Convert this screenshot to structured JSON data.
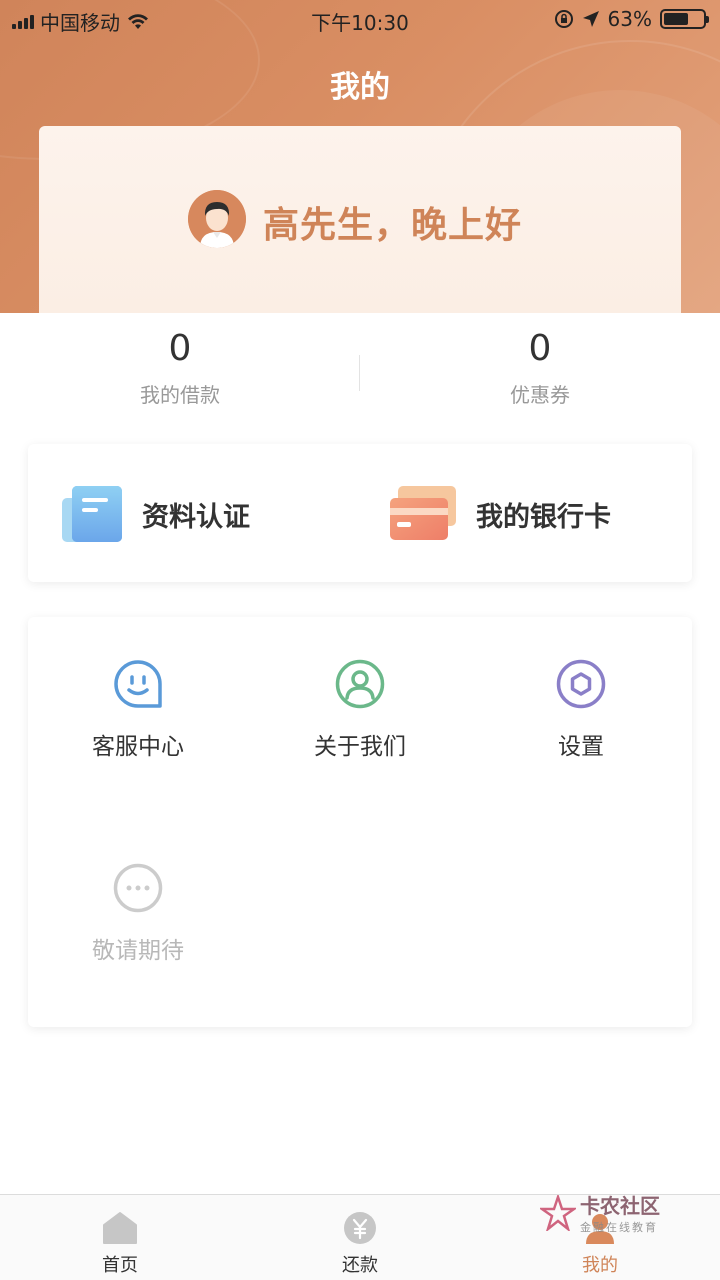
{
  "status_bar": {
    "carrier": "中国移动",
    "time": "下午10:30",
    "battery_percent": "63%",
    "battery_level": 0.63,
    "icons": [
      "signal-icon",
      "wifi-icon",
      "rotation-lock-icon",
      "location-icon",
      "battery-icon"
    ]
  },
  "header": {
    "title": "我的",
    "background_color": "#d98e63"
  },
  "profile": {
    "greeting": "高先生，晚上好",
    "avatar_icon": "user-avatar-icon",
    "accent_color": "#cf8458"
  },
  "stats": [
    {
      "value": "0",
      "label": "我的借款"
    },
    {
      "value": "0",
      "label": "优惠券"
    }
  ],
  "quick_actions": [
    {
      "label": "资料认证",
      "icon": "document-icon"
    },
    {
      "label": "我的银行卡",
      "icon": "bank-card-icon"
    }
  ],
  "services": [
    {
      "label": "客服中心",
      "icon": "smiley-chat-icon",
      "color": "#5a9ad8"
    },
    {
      "label": "关于我们",
      "icon": "user-circle-icon",
      "color": "#6bb88a"
    },
    {
      "label": "设置",
      "icon": "hexagon-settings-icon",
      "color": "#8a7fc8"
    },
    {
      "label": "敬请期待",
      "icon": "more-dots-icon",
      "color": "#cccccc"
    }
  ],
  "tab_bar": {
    "tabs": [
      {
        "label": "首页",
        "icon": "home-icon"
      },
      {
        "label": "还款",
        "icon": "yen-coin-icon"
      },
      {
        "label": "我的",
        "icon": "profile-icon"
      }
    ],
    "active_tab": "我的"
  },
  "watermark": {
    "title": "卡农社区",
    "subtitle": "金融在线教育"
  }
}
